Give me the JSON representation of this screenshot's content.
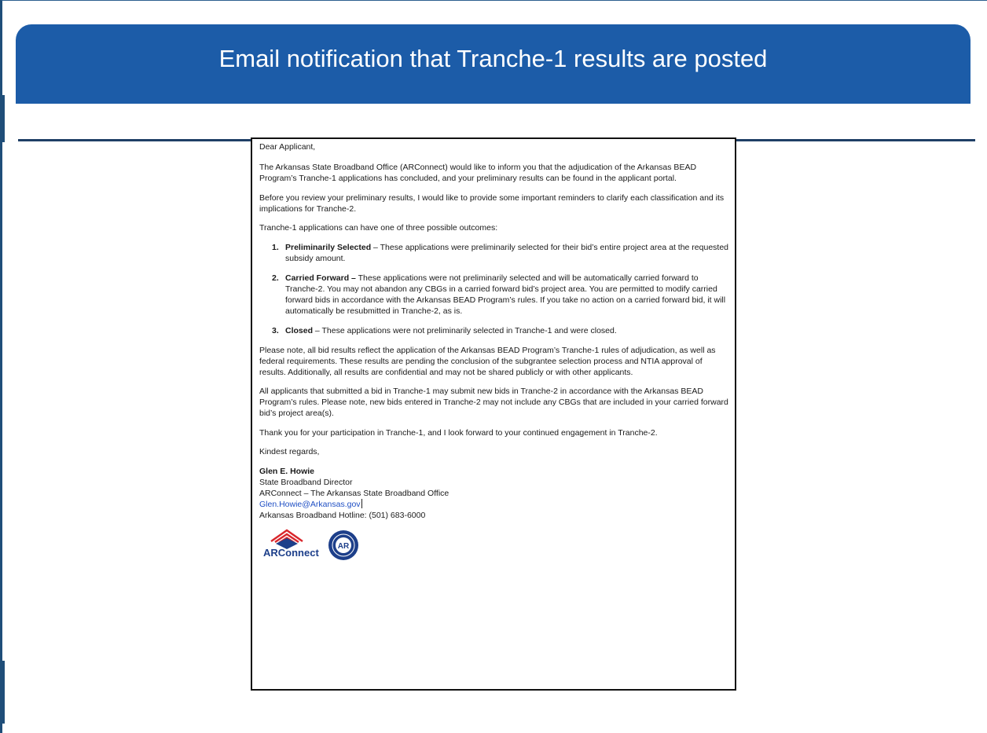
{
  "slide": {
    "title": "Email notification that Tranche-1 results are posted"
  },
  "email": {
    "greeting": "Dear Applicant,",
    "para1": "The Arkansas State Broadband Office (ARConnect) would like to inform you that the adjudication of the Arkansas BEAD Program’s Tranche-1 applications has concluded, and your preliminary results can be found in the applicant portal.",
    "para2": "Before you review your preliminary results, I would like to provide some important reminders to clarify each classification and its implications for Tranche-2.",
    "para3": "Tranche-1 applications can have one of three possible outcomes:",
    "outcomes": [
      {
        "number": "1.",
        "term": "Preliminarily Selected",
        "text": " – These applications were preliminarily selected for their bid’s entire project area at the requested subsidy amount."
      },
      {
        "number": "2.",
        "term": "Carried Forward –",
        "text": " These applications were not preliminarily selected and will be automatically carried forward to Tranche-2. You may not abandon any CBGs in a carried forward bid’s project area. You are permitted to modify carried forward bids in accordance with the Arkansas BEAD Program’s rules. If you take no action on a carried forward bid, it will automatically be resubmitted in Tranche-2, as is."
      },
      {
        "number": "3.",
        "term": "Closed",
        "text": " – These applications were not preliminarily selected in Tranche-1 and were closed."
      }
    ],
    "para4": "Please note, all bid results reflect the application of the Arkansas BEAD Program’s Tranche-1 rules of adjudication, as well as federal requirements. These results are pending the conclusion of the subgrantee selection process and NTIA approval of results. Additionally, all results are confidential and may not be shared publicly or with other applicants.",
    "para5": "All applicants that submitted a bid in Tranche-1 may submit new bids in Tranche-2 in accordance with the Arkansas BEAD Program’s rules. Please note, new bids entered in Tranche-2 may not include any CBGs that are included in your carried forward bid’s project area(s).",
    "para6": "Thank you for your participation in Tranche-1, and I look forward to your continued engagement in Tranche-2.",
    "closing": "Kindest regards,",
    "signature": {
      "name": "Glen E. Howie",
      "title": "State Broadband Director",
      "org": "ARConnect – The Arkansas State Broadband Office",
      "email": "Glen.Howie@Arkansas.gov",
      "hotline": "Arkansas Broadband Hotline: (501) 683-6000"
    },
    "logos": {
      "arconnect_word": "ARConnect",
      "seal_letters": "AR"
    }
  },
  "colors": {
    "banner": "#1c5ca8",
    "rule": "#1f3f66",
    "link": "#1f4fc4",
    "logo_red": "#d9262c",
    "logo_navy": "#1d3f8a"
  }
}
